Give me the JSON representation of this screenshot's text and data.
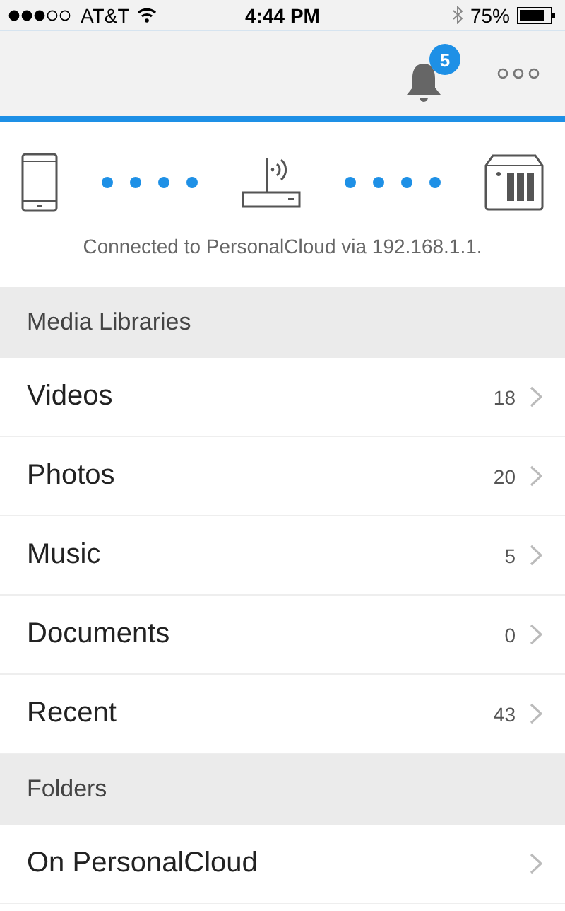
{
  "status_bar": {
    "carrier": "AT&T",
    "time": "4:44 PM",
    "battery": "75%"
  },
  "nav_bar": {
    "notification_count": "5"
  },
  "connection": {
    "message": "Connected to PersonalCloud via 192.168.1.1."
  },
  "sections": [
    {
      "title": "Media Libraries",
      "items": [
        {
          "label": "Videos",
          "count": "18"
        },
        {
          "label": "Photos",
          "count": "20"
        },
        {
          "label": "Music",
          "count": "5"
        },
        {
          "label": "Documents",
          "count": "0"
        },
        {
          "label": "Recent",
          "count": "43"
        }
      ]
    },
    {
      "title": "Folders",
      "items": [
        {
          "label": "On PersonalCloud"
        }
      ]
    }
  ]
}
